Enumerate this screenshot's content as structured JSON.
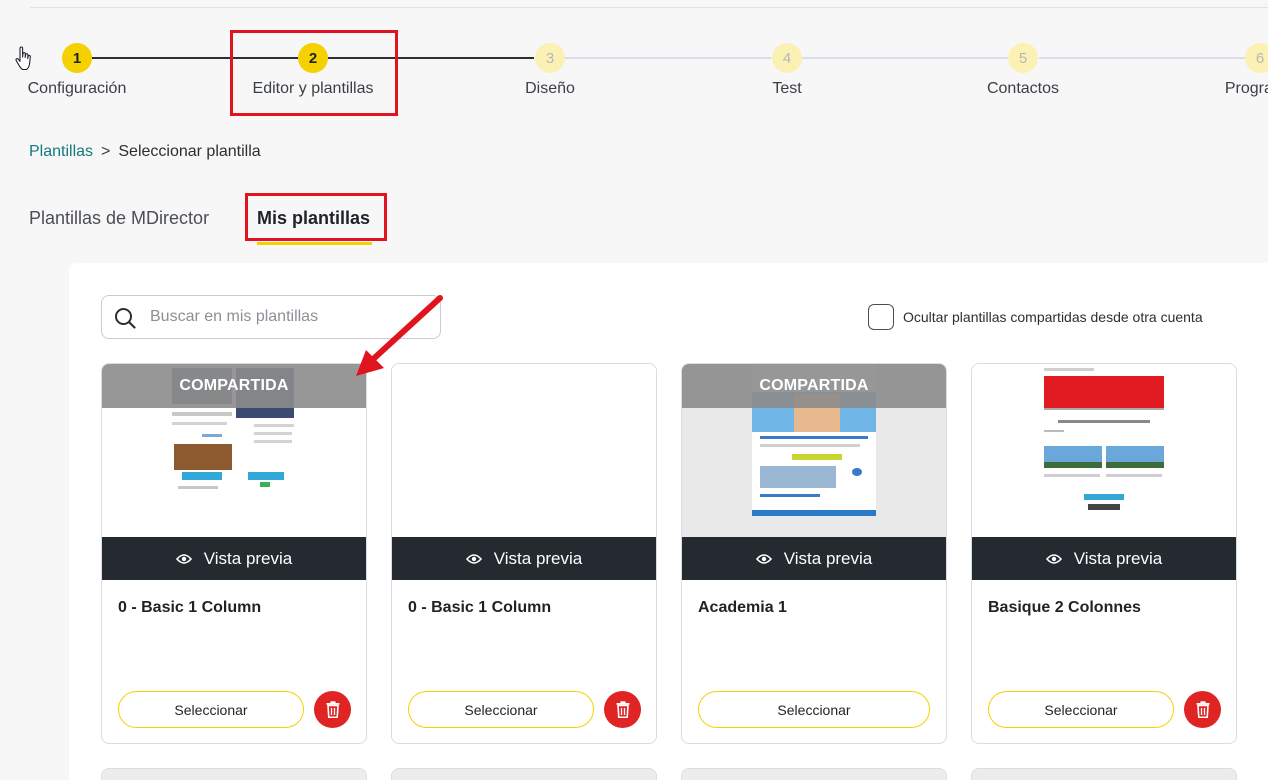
{
  "stepper": {
    "steps": [
      {
        "number": "1",
        "label": "Configuración"
      },
      {
        "number": "2",
        "label": "Editor y plantillas"
      },
      {
        "number": "3",
        "label": "Diseño"
      },
      {
        "number": "4",
        "label": "Test"
      },
      {
        "number": "5",
        "label": "Contactos"
      },
      {
        "number": "6",
        "label": "Programa"
      }
    ]
  },
  "breadcrumb": {
    "link": "Plantillas",
    "separator": ">",
    "current": "Seleccionar plantilla"
  },
  "tabs": {
    "mdirector": "Plantillas de MDirector",
    "mine": "Mis plantillas"
  },
  "search": {
    "placeholder": "Buscar en mis plantillas"
  },
  "filter": {
    "label": "Ocultar plantillas compartidas desde otra cuenta"
  },
  "cards": [
    {
      "title": "0 - Basic 1 Column",
      "shared_label": "COMPARTIDA",
      "preview_label": "Vista previa",
      "select_label": "Seleccionar"
    },
    {
      "title": "0 - Basic 1 Column",
      "preview_label": "Vista previa",
      "select_label": "Seleccionar"
    },
    {
      "title": "Academia 1",
      "shared_label": "COMPARTIDA",
      "preview_label": "Vista previa",
      "select_label": "Seleccionar"
    },
    {
      "title": "Basique 2 Colonnes",
      "preview_label": "Vista previa",
      "select_label": "Seleccionar"
    }
  ],
  "colors": {
    "accent": "#f5d100",
    "dark": "#252a31",
    "link": "#127a80",
    "danger": "#e02424",
    "annotation": "#e0141e"
  }
}
